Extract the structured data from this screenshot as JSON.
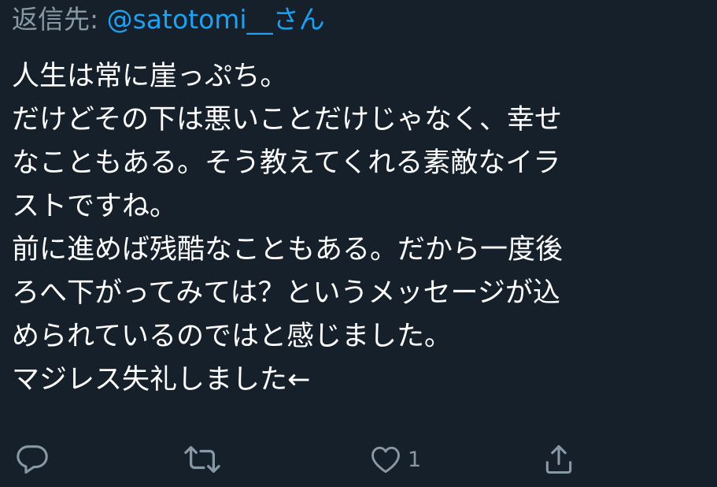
{
  "reply_header": {
    "prefix": "返信先: ",
    "mention": "@satotomi__さん"
  },
  "tweet": {
    "lines": [
      "人生は常に崖っぷち。",
      "だけどその下は悪いことだけじゃなく、幸せ",
      "なこともある。そう教えてくれる素敵なイラ",
      "ストですね。",
      "前に進めば残酷なこともある。だから一度後",
      "ろへ下がってみては？というメッセージが込",
      "められているのではと感じました。",
      "マジレス失礼しました←"
    ]
  },
  "actions": {
    "reply_icon": "comment-icon",
    "retweet_icon": "retweet-icon",
    "like_icon": "heart-icon",
    "like_count": "1",
    "share_icon": "share-icon"
  },
  "colors": {
    "background": "#15202b",
    "text": "#ffffff",
    "muted": "#8899a6",
    "link": "#1da1f2"
  }
}
